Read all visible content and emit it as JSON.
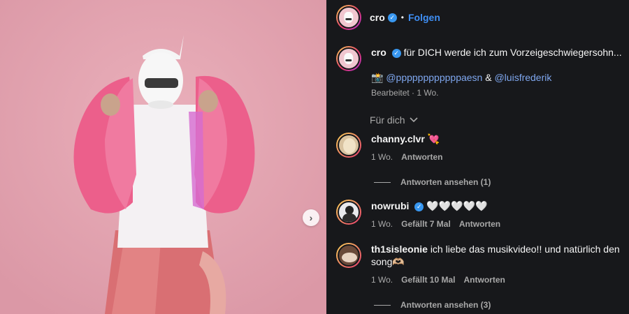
{
  "post": {
    "author": "cro",
    "follow_label": "Folgen",
    "separator": "•",
    "caption_text": "für DICH werde ich zum Vorzeigeschwiegersohn...",
    "tag_icon": "📸",
    "mention_1": "@ppppppppppppaesn",
    "amp": "&",
    "mention_2": "@luisfrederik",
    "edited_meta": "Bearbeitet · 1 Wo."
  },
  "filter": {
    "label": "Für dich"
  },
  "comments": [
    {
      "username": "channy.clvr",
      "text": "💘",
      "time": "1 Wo.",
      "likes": "",
      "reply": "Antworten",
      "view_replies": "Antworten ansehen (1)"
    },
    {
      "username": "nowrubi",
      "text": "🤍🤍🤍🤍🤍",
      "time": "1 Wo.",
      "likes": "Gefällt 7 Mal",
      "reply": "Antworten"
    },
    {
      "username": "th1sisleonie",
      "text": "ich liebe das musikvideo!! und natürlich den song🫶🏼",
      "time": "1 Wo.",
      "likes": "Gefällt 10 Mal",
      "reply": "Antworten",
      "view_replies": "Antworten ansehen (3)"
    }
  ],
  "colors": {
    "background": "#17181b",
    "accent": "#3f8ff5",
    "mention": "#7fa7ef",
    "photo_bg": "#e6a4b0"
  }
}
